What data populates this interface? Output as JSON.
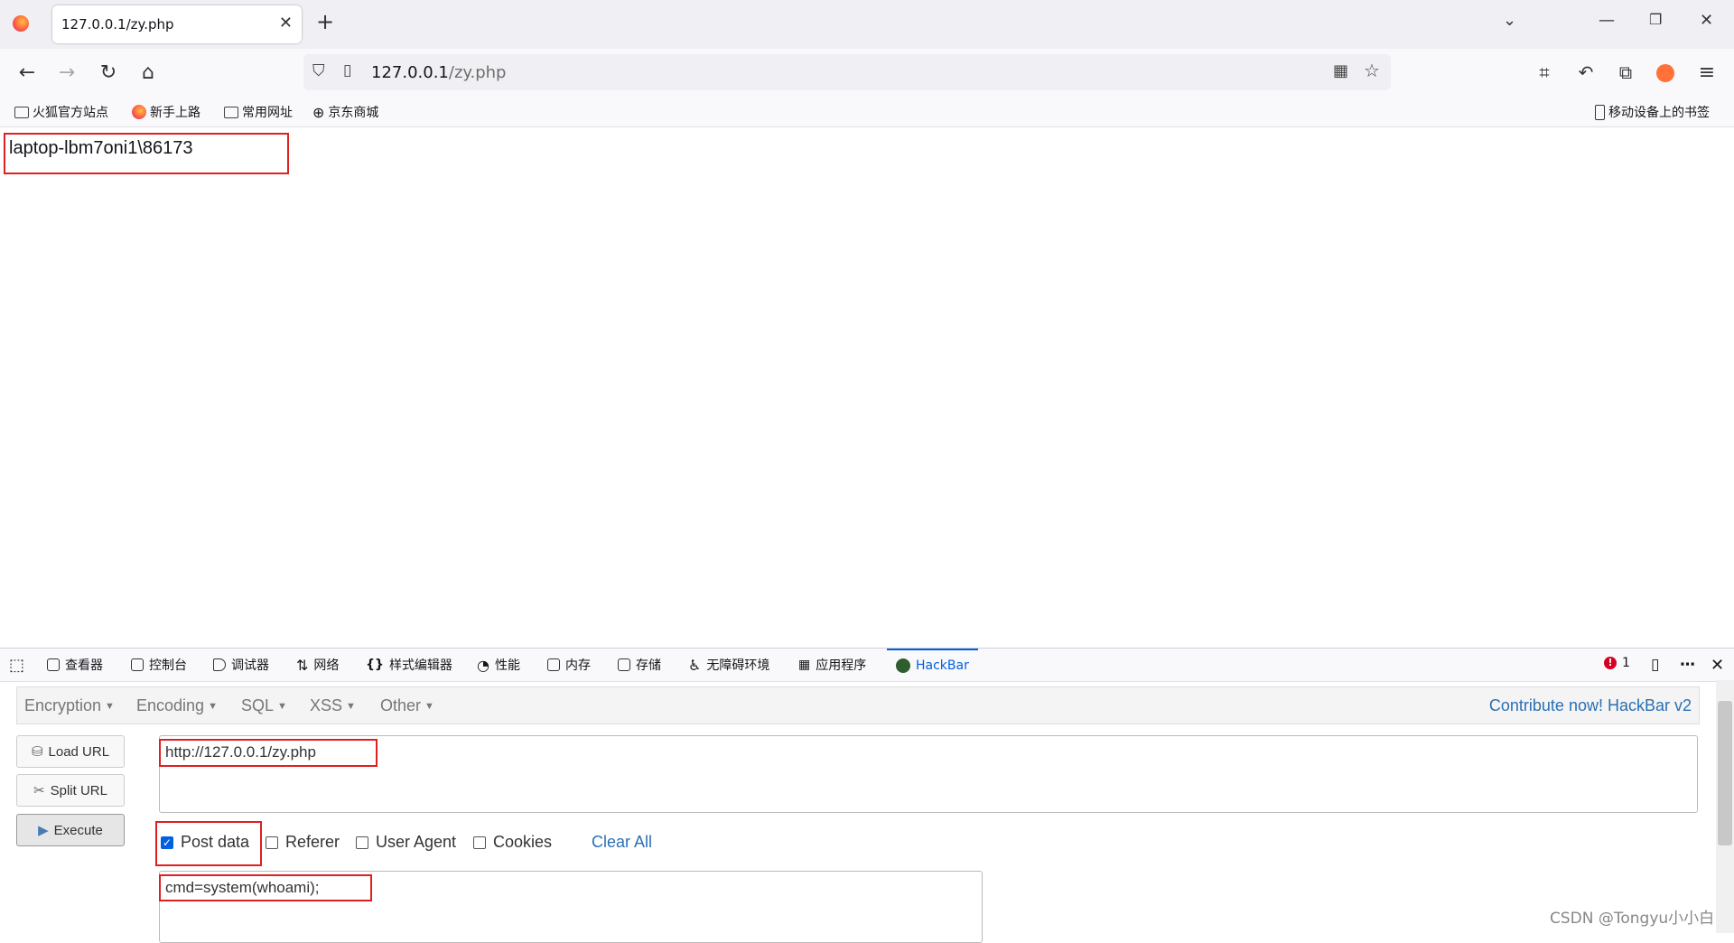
{
  "browser": {
    "tab_title": "127.0.0.1/zy.php",
    "url_host": "127.0.0.1",
    "url_path": "/zy.php",
    "bookmarks": [
      "火狐官方站点",
      "新手上路",
      "常用网址",
      "京东商城"
    ],
    "mobile_bookmarks": "移动设备上的书签"
  },
  "page": {
    "output": "laptop-lbm7oni1\\86173"
  },
  "devtools": {
    "tabs": [
      "查看器",
      "控制台",
      "调试器",
      "网络",
      "样式编辑器",
      "性能",
      "内存",
      "存储",
      "无障碍环境",
      "应用程序",
      "HackBar"
    ],
    "error_count": "1"
  },
  "hackbar": {
    "menus": [
      "Encryption",
      "Encoding",
      "SQL",
      "XSS",
      "Other"
    ],
    "contribute": "Contribute now! HackBar v2",
    "buttons": {
      "load": "Load URL",
      "split": "Split URL",
      "execute": "Execute"
    },
    "url_value": "http://127.0.0.1/zy.php",
    "options": {
      "post": "Post data",
      "referer": "Referer",
      "ua": "User Agent",
      "cookies": "Cookies",
      "clear": "Clear All"
    },
    "post_checked": true,
    "post_value": "cmd=system(whoami);"
  },
  "watermark": "CSDN @Tongyu小小白"
}
